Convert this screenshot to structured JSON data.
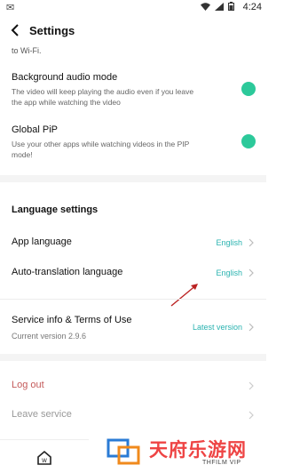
{
  "status_bar": {
    "time": "4:24"
  },
  "header": {
    "title": "Settings"
  },
  "cut_off_text": "to Wi-Fi.",
  "background_audio": {
    "label": "Background audio mode",
    "desc": "The video will keep playing the audio even if you leave the app while watching the video",
    "enabled": true
  },
  "global_pip": {
    "label": "Global PiP",
    "desc": "Use your other apps while watching videos in the PIP mode!",
    "enabled": true
  },
  "language": {
    "section_title": "Language settings",
    "app_language_label": "App language",
    "app_language_value": "English",
    "auto_translation_label": "Auto-translation language",
    "auto_translation_value": "English"
  },
  "service": {
    "label": "Service info & Terms of Use",
    "version": "Current version 2.9.6",
    "status": "Latest version"
  },
  "account": {
    "logout_label": "Log out",
    "leave_label": "Leave service"
  },
  "watermark": {
    "title": "天府乐游网",
    "subtitle": "THFILM VIP"
  },
  "colors": {
    "accent": "#2cc99a",
    "link": "#2ab3b0",
    "danger": "#c45a5a"
  }
}
